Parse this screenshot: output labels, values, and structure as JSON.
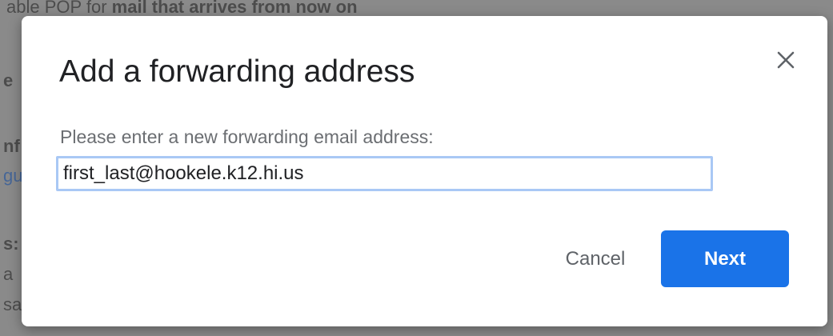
{
  "background": {
    "line1_prefix": "able POP for ",
    "line1_bold": "mail that arrives from now on",
    "line2": "e",
    "line3": "nf",
    "line4_link": "gu",
    "line5": "s:",
    "line6": "a",
    "line7": "sa"
  },
  "dialog": {
    "title": "Add a forwarding address",
    "prompt": "Please enter a new forwarding email address:",
    "email_value": "first_last@hookele.k12.hi.us",
    "cancel_label": "Cancel",
    "next_label": "Next",
    "close_icon": "close-icon"
  },
  "colors": {
    "primary": "#1a73e8",
    "input_focus_border": "#a9c8f5",
    "title_text": "#202124",
    "secondary_text": "#5f6368",
    "overlay": "#8a8a8a"
  }
}
